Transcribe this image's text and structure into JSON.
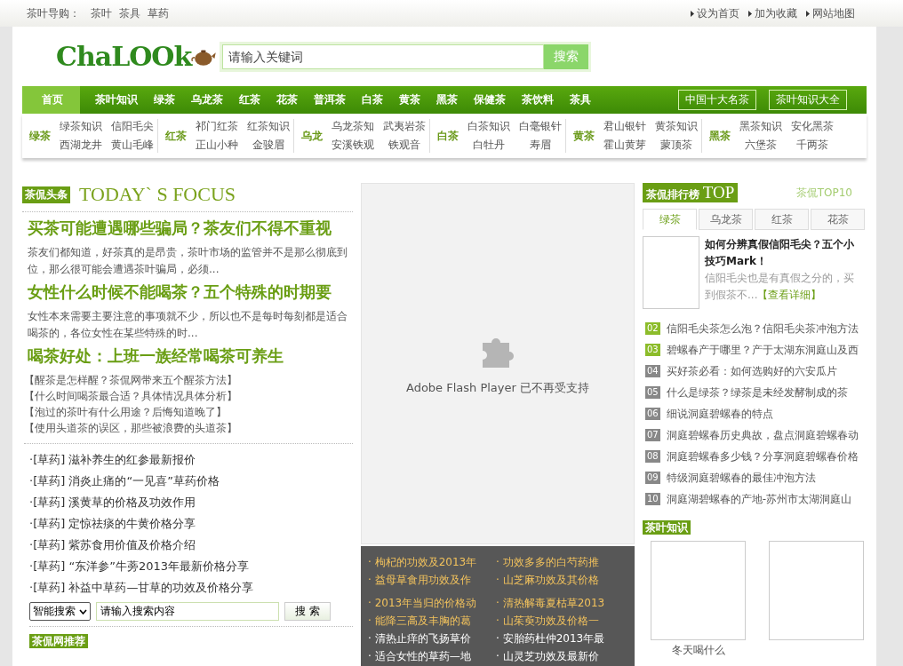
{
  "top_bar": {
    "guide_label": "茶叶导购：",
    "guide_links": [
      "茶叶",
      "茶具",
      "草药"
    ],
    "right_links": [
      "设为首页",
      "加为收藏",
      "网站地图"
    ]
  },
  "header": {
    "logo": "ChaLOOk",
    "search": {
      "placeholder": "请输入关键词",
      "button": "搜索"
    }
  },
  "nav": {
    "items": [
      {
        "label": "首页",
        "selected": true
      },
      {
        "label": "茶叶知识",
        "selected": false
      },
      {
        "label": "绿茶",
        "selected": false
      },
      {
        "label": "乌龙茶",
        "selected": false
      },
      {
        "label": "红茶",
        "selected": false
      },
      {
        "label": "花茶",
        "selected": false
      },
      {
        "label": "普洱茶",
        "selected": false
      },
      {
        "label": "白茶",
        "selected": false
      },
      {
        "label": "黄茶",
        "selected": false
      },
      {
        "label": "黑茶",
        "selected": false
      },
      {
        "label": "保健茶",
        "selected": false
      },
      {
        "label": "茶饮料",
        "selected": false
      },
      {
        "label": "茶具",
        "selected": false
      }
    ],
    "buttons": [
      "中国十大名茶",
      "茶叶知识大全"
    ]
  },
  "sub_nav": [
    {
      "title": "绿茶",
      "links": [
        "绿茶知识",
        "信阳毛尖",
        "西湖龙井",
        "黄山毛峰"
      ]
    },
    {
      "title": "红茶",
      "links": [
        "祁门红茶",
        "红茶知识",
        "正山小种",
        "金骏眉"
      ]
    },
    {
      "title": "乌龙",
      "links": [
        "乌龙茶知",
        "武夷岩茶",
        "安溪铁观",
        "铁观音"
      ]
    },
    {
      "title": "白茶",
      "links": [
        "白茶知识",
        "白毫银针",
        "白牡丹",
        "寿眉"
      ]
    },
    {
      "title": "黄茶",
      "links": [
        "君山银针",
        "黄茶知识",
        "霍山黄芽",
        "蒙顶茶"
      ]
    },
    {
      "title": "黑茶",
      "links": [
        "黑茶知识",
        "安化黑茶",
        "六堡茶",
        "千两茶"
      ]
    }
  ],
  "focus": {
    "badge": "茶侃头条",
    "title": "TODAY` S FOCUS",
    "stories": [
      {
        "headline": "买茶可能遭遇哪些骗局？茶友们不得不重视",
        "summary": "茶友们都知道，好茶真的是昂贵，茶叶市场的监管并不是那么彻底到位，那么很可能会遭遇茶叶骗局，必须..."
      },
      {
        "headline": "女性什么时候不能喝茶？五个特殊的时期要",
        "summary": "女性本来需要主要注意的事项就不少，所以也不是每时每刻都是适合喝茶的，各位女性在某些特殊的时..."
      },
      {
        "headline": "喝茶好处：上班一族经常喝茶可养生"
      }
    ],
    "links": [
      "【醒茶是怎样醒？茶侃网带来五个醒茶方法】",
      "【什么时间喝茶最合适？具体情况具体分析】",
      "【泡过的茶叶有什么用途？后悔知道晚了】",
      "【使用头道茶的误区，那些被浪费的头道茶】"
    ]
  },
  "herb_list": [
    {
      "tag": "·[草药]",
      "title": "滋补养生的红参最新报价"
    },
    {
      "tag": "·[草药]",
      "title": "消炎止痛的“一见喜”草药价格"
    },
    {
      "tag": "·[草药]",
      "title": "溪黄草的价格及功效作用"
    },
    {
      "tag": "·[草药]",
      "title": "定惊祛痰的牛黄价格分享"
    },
    {
      "tag": "·[草药]",
      "title": "紫苏食用价值及价格介绍"
    },
    {
      "tag": "·[草药]",
      "title": "“东洋参”牛蒡2013年最新价格分享"
    },
    {
      "tag": "·[草药]",
      "title": "补益中草药—甘草的功效及价格分享"
    }
  ],
  "site_search": {
    "select": "智能搜索",
    "value": "请输入搜索内容",
    "button": "搜 索"
  },
  "recommend_badge": "茶侃网推荐",
  "flash": {
    "message": "Adobe Flash Player 已不再受支持"
  },
  "herb_panel": [
    [
      {
        "text": "· 枸杞的功效及2013年",
        "highlighted": true
      },
      {
        "text": "· 功效多多的白芍药推",
        "highlighted": true
      }
    ],
    [
      {
        "text": "· 益母草食用功效及作",
        "highlighted": true
      },
      {
        "text": "· 山芝麻功效及其价格",
        "highlighted": true
      }
    ],
    [
      {
        "text": "· 2013年当归的价格动",
        "highlighted": true
      },
      {
        "text": "· 清热解毒夏枯草2013",
        "highlighted": true
      }
    ],
    [
      {
        "text": "· 能降三高及丰胸的葛",
        "highlighted": true
      },
      {
        "text": "· 山茱萸功效及价格一",
        "highlighted": true
      }
    ],
    [
      {
        "text": "· 清热止痒的飞扬草价",
        "highlighted": false
      },
      {
        "text": "· 安胎药杜仲2013年最",
        "highlighted": false
      }
    ],
    [
      {
        "text": "· 适合女性的草药—地",
        "highlighted": false
      },
      {
        "text": "· 山灵芝功效及最新价",
        "highlighted": false
      }
    ]
  ],
  "ranking": {
    "badge": "茶侃排行榜",
    "badge_title": "TOP",
    "subtitle": "茶侃TOP10",
    "tabs": [
      {
        "label": "绿茶",
        "selected": true
      },
      {
        "label": "乌龙茶",
        "selected": false
      },
      {
        "label": "红茶",
        "selected": false
      },
      {
        "label": "花茶",
        "selected": false
      }
    ],
    "featured": {
      "title": "如何分辨真假信阳毛尖？五个小技巧Mark！",
      "summary": "信阳毛尖也是有真假之分的，买到假茶不...",
      "more": "【查看详细】"
    },
    "items": [
      {
        "rank": "02",
        "highlighted": true,
        "title": "信阳毛尖茶怎么泡？信阳毛尖茶冲泡方法"
      },
      {
        "rank": "03",
        "highlighted": true,
        "title": "碧螺春产于哪里？产于太湖东洞庭山及西"
      },
      {
        "rank": "04",
        "highlighted": false,
        "title": "买好茶必看：如何选购好的六安瓜片"
      },
      {
        "rank": "05",
        "highlighted": false,
        "title": "什么是绿茶？绿茶是未经发酵制成的茶"
      },
      {
        "rank": "06",
        "highlighted": false,
        "title": "细说洞庭碧螺春的特点"
      },
      {
        "rank": "07",
        "highlighted": false,
        "title": "洞庭碧螺春历史典故，盘点洞庭碧螺春动"
      },
      {
        "rank": "08",
        "highlighted": false,
        "title": "洞庭碧螺春多少钱？分享洞庭碧螺春价格"
      },
      {
        "rank": "09",
        "highlighted": false,
        "title": "特级洞庭碧螺春的最佳冲泡方法"
      },
      {
        "rank": "10",
        "highlighted": false,
        "title": "洞庭湖碧螺春的产地-苏州市太湖洞庭山"
      }
    ]
  },
  "knowledge": {
    "badge": "茶叶知识",
    "cards": [
      {
        "caption": "冬天喝什么"
      }
    ]
  }
}
